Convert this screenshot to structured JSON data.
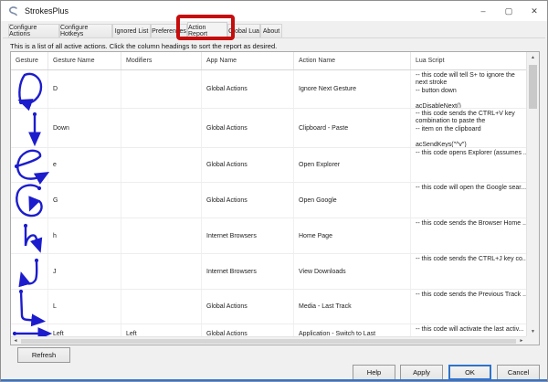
{
  "window": {
    "title": "StrokesPlus"
  },
  "titlebar": {
    "controls": {
      "minimize": "–",
      "maximize": "▢",
      "close": "✕"
    }
  },
  "tabs": [
    {
      "label": "Configure Actions",
      "active": false
    },
    {
      "label": "Configure Hotkeys",
      "active": false
    },
    {
      "label": "Ignored List",
      "active": false
    },
    {
      "label": "Preferences",
      "active": false
    },
    {
      "label": "Action Report",
      "active": true,
      "annotated": true
    },
    {
      "label": "Global Lua",
      "active": false
    },
    {
      "label": "About",
      "active": false
    }
  ],
  "description": "This is a list of all active actions.  Click the column headings to sort the report as desired.",
  "table": {
    "columns": [
      "Gesture",
      "Gesture Name",
      "Modifiers",
      "App Name",
      "Action Name",
      "Lua Script"
    ],
    "rows": [
      {
        "gesture": "D",
        "gesture_name": "D",
        "modifiers": "",
        "app_name": "Global Actions",
        "action_name": "Ignore Next Gesture",
        "lua_script": "-- this code will tell S+ to ignore the\nnext stroke\n-- button down\n\nacDisableNext()"
      },
      {
        "gesture": "Down",
        "gesture_name": "Down",
        "modifiers": "",
        "app_name": "Global Actions",
        "action_name": "Clipboard - Paste",
        "lua_script": "-- this code sends the CTRL+V key\ncombination to paste the\n-- item on the clipboard\n\nacSendKeys(\"^v\")"
      },
      {
        "gesture": "e",
        "gesture_name": "e",
        "modifiers": "",
        "app_name": "Global Actions",
        "action_name": "Open Explorer",
        "lua_script": "-- this code opens Explorer (assumes ..."
      },
      {
        "gesture": "G",
        "gesture_name": "G",
        "modifiers": "",
        "app_name": "Global Actions",
        "action_name": "Open Google",
        "lua_script": "-- this code will open the Google sear..."
      },
      {
        "gesture": "h",
        "gesture_name": "h",
        "modifiers": "",
        "app_name": "Internet Browsers",
        "action_name": "Home Page",
        "lua_script": "-- this code sends the Browser Home ..."
      },
      {
        "gesture": "J",
        "gesture_name": "J",
        "modifiers": "",
        "app_name": "Internet Browsers",
        "action_name": "View Downloads",
        "lua_script": "-- this code sends the CTRL+J key co..."
      },
      {
        "gesture": "L",
        "gesture_name": "L",
        "modifiers": "",
        "app_name": "Global Actions",
        "action_name": "Media - Last Track",
        "lua_script": "-- this code sends the Previous Track ..."
      },
      {
        "gesture": "Left",
        "gesture_name": "Left",
        "modifiers": "Left",
        "app_name": "Global Actions",
        "action_name": "Application - Switch to Last",
        "lua_script": "-- this code will activate the last activ..."
      }
    ]
  },
  "buttons": {
    "refresh": "Refresh",
    "help": "Help",
    "apply": "Apply",
    "ok": "OK",
    "cancel": "Cancel"
  },
  "colors": {
    "accent": "#2f74d8",
    "gesture_stroke": "#1c1ccd",
    "annotation_red": "#c60d0d"
  }
}
